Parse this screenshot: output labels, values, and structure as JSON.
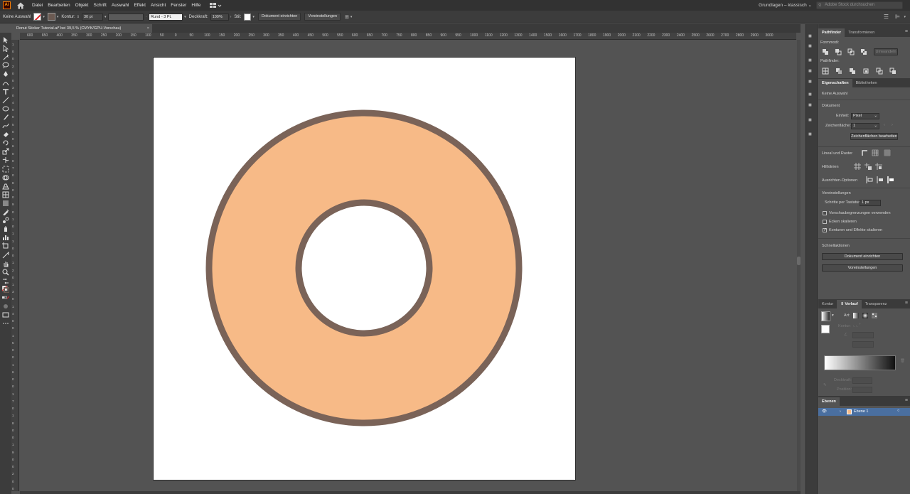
{
  "menubar": {
    "app_logo": "Ai",
    "items": [
      "Datei",
      "Bearbeiten",
      "Objekt",
      "Schrift",
      "Auswahl",
      "Effekt",
      "Ansicht",
      "Fenster",
      "Hilfe"
    ],
    "underline": [
      "D",
      "B",
      "O",
      "S",
      "A",
      "k",
      "A",
      "F",
      "H"
    ],
    "workspace": "Grundlagen – klassisch",
    "search_placeholder": "Adobe Stock durchsuchen"
  },
  "controlbar": {
    "selection": "Keine Auswahl",
    "stroke_label": "Kontur:",
    "stroke_value": "30 pt",
    "brush_value": "Rund - 3 Pt.",
    "opacity_label": "Deckkraft:",
    "opacity_value": "100%",
    "style_label": "Stil:",
    "doc_setup_button": "Dokument einrichten",
    "prefs_button": "Voreinstellungen"
  },
  "document": {
    "tab_title": "Donut Sticker Tutorial.ai* bei 39,5 % (CMYK/GPU-Vorschau)",
    "close": "×"
  },
  "ruler": {
    "h_labels": [
      "600",
      "650",
      "400",
      "350",
      "300",
      "250",
      "200",
      "150",
      "100",
      "50",
      "0",
      "50",
      "100",
      "150",
      "200",
      "250",
      "300",
      "350",
      "400",
      "450",
      "500",
      "550",
      "600",
      "650",
      "700",
      "750",
      "800",
      "850",
      "900",
      "950",
      "1000",
      "1100",
      "1200",
      "1300",
      "1400",
      "1500",
      "1600",
      "1700",
      "1800",
      "1900",
      "2000",
      "2100",
      "2200",
      "2300",
      "2400",
      "2500",
      "2600",
      "2700",
      "2800",
      "2900",
      "3000"
    ],
    "v_labels": [
      "1",
      "0",
      "0",
      "2",
      "0",
      "0",
      "3",
      "0",
      "4",
      "0",
      "0",
      "5",
      "0",
      "0",
      "6",
      "0",
      "0",
      "7",
      "0",
      "8",
      "0",
      "0",
      "9",
      "0",
      "1",
      "0",
      "1",
      "1",
      "0",
      "0",
      "1",
      "2",
      "0",
      "1",
      "3",
      "0",
      "1",
      "4",
      "0",
      "0",
      "1",
      "5",
      "0",
      "0",
      "1",
      "6",
      "0",
      "0",
      "1",
      "7",
      "0",
      "1",
      "8",
      "0",
      "0",
      "1",
      "9",
      "0",
      "0",
      "2",
      "0",
      "0"
    ]
  },
  "artwork": {
    "fill_color": "#f7ba87",
    "stroke_color": "#7a6358",
    "hole_color": "#ffffff"
  },
  "pathfinder": {
    "tabs": [
      "Pathfinder",
      "Transformieren"
    ],
    "shape_modes_label": "Formmodi:",
    "expand_button": "Umwandeln",
    "pathfinder_label": "Pathfinder:"
  },
  "properties": {
    "tabs": [
      "Eigenschaften",
      "Bibliotheken"
    ],
    "no_selection": "Keine Auswahl",
    "document_label": "Dokument",
    "units_label": "Einheit:",
    "units_value": "Pixel",
    "artboard_label": "Zeichenfläche:",
    "artboard_value": "1",
    "edit_artboards_button": "Zeichenflächen bearbeiten",
    "rulers_grids_label": "Lineal und Raster",
    "guides_label": "Hilfslinien",
    "align_options_label": "Ausrichten-Optionen",
    "preferences_label": "Voreinstellungen",
    "key_increment_label": "Schritte per Tastatur:",
    "key_increment_value": "1 px",
    "preview_bounds_label": "Vorschaubegrenzungen verwenden",
    "scale_corners_label": "Ecken skalieren",
    "scale_strokes_label": "Konturen und Effekte skalieren",
    "quick_actions_label": "Schnellaktionen",
    "doc_setup_button": "Dokument einrichten",
    "prefs_button": "Voreinstellungen"
  },
  "gradient": {
    "tabs": [
      "Kontur",
      "Verlauf",
      "Transparenz"
    ],
    "type_label": "Art:",
    "stroke_label": "Kontur:",
    "opacity_label": "Deckkraft:",
    "position_label": "Position:"
  },
  "layers": {
    "tabs": [
      "Ebenen"
    ],
    "layer_name": "Ebene 1"
  }
}
